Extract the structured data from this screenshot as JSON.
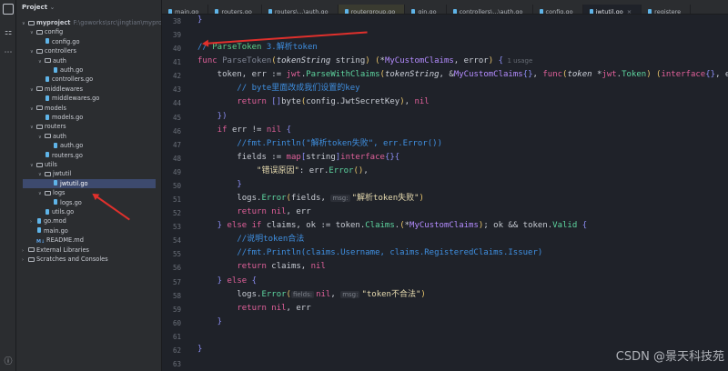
{
  "project": {
    "title": "Project",
    "root": "myproject",
    "root_path": "F:\\goworks\\src\\jingtian\\myproj",
    "tree": [
      {
        "label": "config",
        "kind": "folder",
        "depth": 1,
        "open": true
      },
      {
        "label": "config.go",
        "kind": "go",
        "depth": 2
      },
      {
        "label": "controllers",
        "kind": "folder",
        "depth": 1,
        "open": true
      },
      {
        "label": "auth",
        "kind": "folder",
        "depth": 2,
        "open": true
      },
      {
        "label": "auth.go",
        "kind": "go",
        "depth": 3
      },
      {
        "label": "controllers.go",
        "kind": "go",
        "depth": 2
      },
      {
        "label": "middlewares",
        "kind": "folder",
        "depth": 1,
        "open": true
      },
      {
        "label": "middlewares.go",
        "kind": "go",
        "depth": 2
      },
      {
        "label": "models",
        "kind": "folder",
        "depth": 1,
        "open": true
      },
      {
        "label": "models.go",
        "kind": "go",
        "depth": 2
      },
      {
        "label": "routers",
        "kind": "folder",
        "depth": 1,
        "open": true
      },
      {
        "label": "auth",
        "kind": "folder",
        "depth": 2,
        "open": true
      },
      {
        "label": "auth.go",
        "kind": "go",
        "depth": 3
      },
      {
        "label": "routers.go",
        "kind": "go",
        "depth": 2
      },
      {
        "label": "utils",
        "kind": "folder",
        "depth": 1,
        "open": true
      },
      {
        "label": "jwtutil",
        "kind": "folder",
        "depth": 2,
        "open": true
      },
      {
        "label": "jwtutil.go",
        "kind": "go",
        "depth": 3,
        "selected": true
      },
      {
        "label": "logs",
        "kind": "folder",
        "depth": 2,
        "open": true
      },
      {
        "label": "logs.go",
        "kind": "go",
        "depth": 3
      },
      {
        "label": "utils.go",
        "kind": "go",
        "depth": 2
      },
      {
        "label": "go.mod",
        "kind": "go",
        "depth": 1,
        "collapsed": true
      },
      {
        "label": "main.go",
        "kind": "go",
        "depth": 1
      },
      {
        "label": "README.md",
        "kind": "md",
        "depth": 1
      },
      {
        "label": "External Libraries",
        "kind": "lib",
        "depth": 0,
        "collapsed": true
      },
      {
        "label": "Scratches and Consoles",
        "kind": "lib",
        "depth": 0,
        "collapsed": true
      }
    ]
  },
  "tabs": [
    {
      "label": "main.go"
    },
    {
      "label": "routers.go"
    },
    {
      "label": "routers\\...\\auth.go"
    },
    {
      "label": "routergroup.go",
      "modified": true
    },
    {
      "label": "gin.go"
    },
    {
      "label": "controllers\\...\\auth.go"
    },
    {
      "label": "config.go"
    },
    {
      "label": "jwtutil.go",
      "active": true
    },
    {
      "label": "registere"
    }
  ],
  "editor": {
    "first_line": 38,
    "lines": [
      [
        [
          "b",
          "}"
        ]
      ],
      [],
      [
        [
          "c",
          "// "
        ],
        [
          "d",
          "ParseToken "
        ],
        [
          "c",
          "3.解析token"
        ]
      ],
      [
        [
          "k",
          "func "
        ],
        [
          "fd",
          "ParseToken"
        ],
        [
          "y",
          "("
        ],
        [
          "p",
          "tokenString "
        ],
        [
          "n",
          "string"
        ],
        [
          "y",
          ")"
        ],
        [
          "n",
          " "
        ],
        [
          "y",
          "("
        ],
        [
          "n",
          "*"
        ],
        [
          "t",
          "MyCustomClaims"
        ],
        [
          "n",
          ", error"
        ],
        [
          "y",
          ")"
        ],
        [
          "n",
          " "
        ],
        [
          "b",
          "{"
        ],
        [
          "u",
          "  1 usage"
        ]
      ],
      [
        [
          "n",
          "    token, err := "
        ],
        [
          "k",
          "jwt"
        ],
        [
          "n",
          "."
        ],
        [
          "f",
          "ParseWithClaims"
        ],
        [
          "y",
          "("
        ],
        [
          "p",
          "tokenString"
        ],
        [
          "n",
          ", &"
        ],
        [
          "t",
          "MyCustomClaims"
        ],
        [
          "b",
          "{}"
        ],
        [
          "n",
          ", "
        ],
        [
          "k",
          "func"
        ],
        [
          "y",
          "("
        ],
        [
          "p",
          "token "
        ],
        [
          "n",
          "*"
        ],
        [
          "k",
          "jwt"
        ],
        [
          "n",
          "."
        ],
        [
          "f",
          "Token"
        ],
        [
          "y",
          ")"
        ],
        [
          "n",
          " "
        ],
        [
          "y",
          "("
        ],
        [
          "k",
          "interface"
        ],
        [
          "b",
          "{}"
        ],
        [
          "n",
          ", erro"
        ]
      ],
      [
        [
          "c",
          "        // byte里面改成我们设置的key"
        ]
      ],
      [
        [
          "k",
          "        return "
        ],
        [
          "b",
          "[]"
        ],
        [
          "n",
          "byte"
        ],
        [
          "y",
          "("
        ],
        [
          "n",
          "config.JwtSecretKey"
        ],
        [
          "y",
          ")"
        ],
        [
          "n",
          ", "
        ],
        [
          "k",
          "nil"
        ]
      ],
      [
        [
          "b",
          "    })"
        ]
      ],
      [
        [
          "k",
          "    if "
        ],
        [
          "n",
          "err != "
        ],
        [
          "k",
          "nil "
        ],
        [
          "b",
          "{"
        ]
      ],
      [
        [
          "c",
          "        //fmt.Println(\"解析token失败\", err.Error())"
        ]
      ],
      [
        [
          "n",
          "        fields := "
        ],
        [
          "k",
          "map"
        ],
        [
          "b",
          "["
        ],
        [
          "n",
          "string"
        ],
        [
          "b",
          "]"
        ],
        [
          "k",
          "interface"
        ],
        [
          "b",
          "{}{"
        ]
      ],
      [
        [
          "s",
          "            \"错误原因\""
        ],
        [
          "n",
          ": err."
        ],
        [
          "f",
          "Error"
        ],
        [
          "y",
          "()"
        ],
        [
          "n",
          ","
        ]
      ],
      [
        [
          "b",
          "        }"
        ]
      ],
      [
        [
          "n",
          "        logs."
        ],
        [
          "f",
          "Error"
        ],
        [
          "y",
          "("
        ],
        [
          "n",
          "fields, "
        ],
        [
          "h",
          "msg:"
        ],
        [
          "s",
          "\"解析token失败\""
        ],
        [
          "y",
          ")"
        ]
      ],
      [
        [
          "k",
          "        return "
        ],
        [
          "k",
          "nil"
        ],
        [
          "n",
          ", err"
        ]
      ],
      [
        [
          "b",
          "    } "
        ],
        [
          "k",
          "else if "
        ],
        [
          "n",
          "claims, ok := token."
        ],
        [
          "f",
          "Claims"
        ],
        [
          "n",
          "."
        ],
        [
          "y",
          "("
        ],
        [
          "n",
          "*"
        ],
        [
          "t",
          "MyCustomClaims"
        ],
        [
          "y",
          ")"
        ],
        [
          "n",
          "; ok && token."
        ],
        [
          "f",
          "Valid "
        ],
        [
          "b",
          "{"
        ]
      ],
      [
        [
          "c",
          "        //说明token合法"
        ]
      ],
      [
        [
          "c",
          "        //fmt.Println(claims.Username, claims.RegisteredClaims.Issuer)"
        ]
      ],
      [
        [
          "k",
          "        return "
        ],
        [
          "n",
          "claims, "
        ],
        [
          "k",
          "nil"
        ]
      ],
      [
        [
          "b",
          "    } "
        ],
        [
          "k",
          "else "
        ],
        [
          "b",
          "{"
        ]
      ],
      [
        [
          "n",
          "        logs."
        ],
        [
          "f",
          "Error"
        ],
        [
          "y",
          "("
        ],
        [
          "h",
          "fields:"
        ],
        [
          "k",
          "nil"
        ],
        [
          "n",
          ", "
        ],
        [
          "h",
          "msg:"
        ],
        [
          "s",
          "\"token不合法\""
        ],
        [
          "y",
          ")"
        ]
      ],
      [
        [
          "k",
          "        return "
        ],
        [
          "k",
          "nil"
        ],
        [
          "n",
          ", err"
        ]
      ],
      [
        [
          "b",
          "    }"
        ]
      ],
      [],
      [
        [
          "b",
          "}"
        ]
      ],
      []
    ]
  },
  "watermark": "CSDN @景天科技苑"
}
